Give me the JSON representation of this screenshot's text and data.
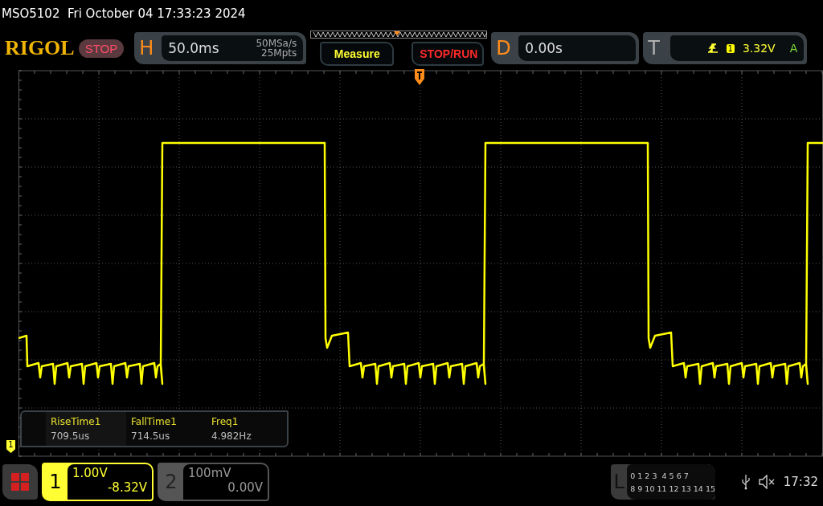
{
  "status_line": "MSO5102  Fri October 04 17:33:23 2024",
  "logo": "RIGOL",
  "run_state": "STOP",
  "horizontal": {
    "label": "H",
    "timebase": "50.0ms",
    "sample_rate": "50MSa/s",
    "memory_depth": "25Mpts"
  },
  "buttons": [
    {
      "label": "Measure",
      "kind": "menu"
    },
    {
      "label": "STOP/RUN",
      "kind": "run"
    }
  ],
  "delay": {
    "label": "D",
    "value": "0.00s"
  },
  "trigger": {
    "label": "T",
    "source": "1",
    "level": "3.32V",
    "mode": "A"
  },
  "channel_marker": "1",
  "measurements": [
    {
      "name": "RiseTime1",
      "value": "709.5us"
    },
    {
      "name": "FallTime1",
      "value": "714.5us"
    },
    {
      "name": "Freq1",
      "value": "4.982Hz"
    }
  ],
  "channels": [
    {
      "number": "1",
      "scale": "1.00V",
      "offset": "-8.32V",
      "selected": true
    },
    {
      "number": "2",
      "scale": "100mV",
      "offset": "0.00V",
      "selected": false
    }
  ],
  "logic": {
    "label": "L",
    "rows": [
      "0 1 2 3  4 5 6 7",
      "8 9 10 11 12 13 14 15"
    ]
  },
  "clock": "17:32"
}
